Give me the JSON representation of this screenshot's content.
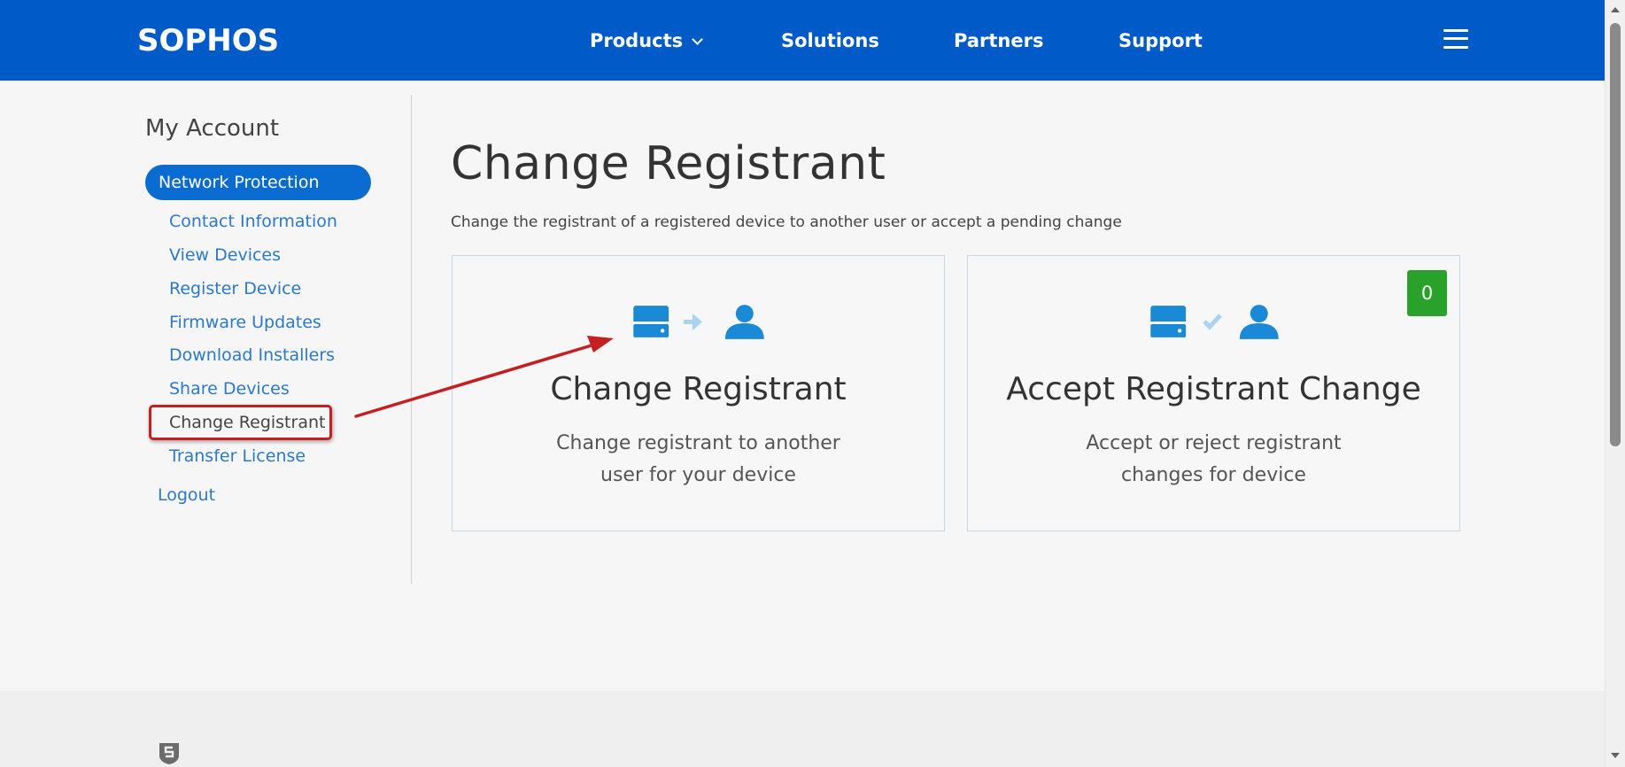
{
  "header": {
    "logo": "SOPHOS",
    "nav": {
      "products": "Products",
      "solutions": "Solutions",
      "partners": "Partners",
      "support": "Support"
    }
  },
  "sidebar": {
    "title": "My Account",
    "active_item": "Network Protection",
    "items": [
      "Contact Information",
      "View Devices",
      "Register Device",
      "Firmware Updates",
      "Download Installers",
      "Share Devices",
      "Change Registrant",
      "Transfer License"
    ],
    "logout": "Logout"
  },
  "main": {
    "title": "Change Registrant",
    "description": "Change the registrant of a registered device to another user or accept a pending change",
    "cards": [
      {
        "title": "Change Registrant",
        "text_line1": "Change registrant to another",
        "text_line2": "user for your device",
        "icons": [
          "device-icon",
          "arrow-right-icon",
          "user-icon"
        ]
      },
      {
        "title": "Accept Registrant Change",
        "text_line1": "Accept or reject registrant",
        "text_line2": "changes for device",
        "badge": "0",
        "icons": [
          "device-icon",
          "checkmark-icon",
          "user-icon"
        ]
      }
    ]
  },
  "colors": {
    "brand_blue": "#005bc8",
    "link_blue": "#2b79c8",
    "badge_green": "#2aa12a",
    "annotation_red": "#c52021",
    "icon_blue": "#1a8ad6"
  }
}
